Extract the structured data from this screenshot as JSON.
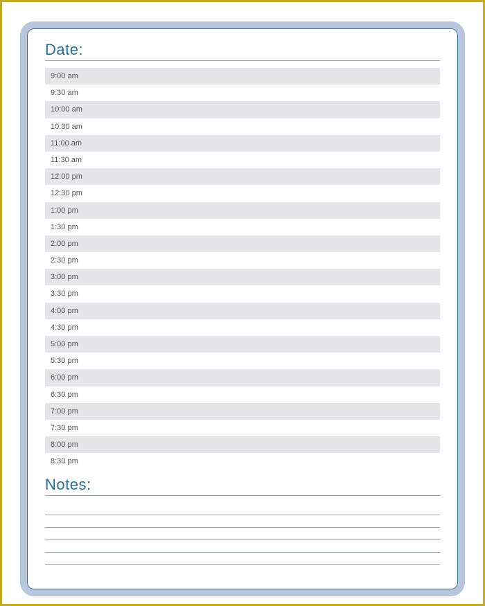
{
  "headings": {
    "date": "Date:",
    "notes": "Notes:"
  },
  "time_slots": [
    "9:00 am",
    "9:30 am",
    "10:00 am",
    "10:30 am",
    "11:00 am",
    "11:30 am",
    "12:00 pm",
    "12:30 pm",
    "1:00 pm",
    "1:30 pm",
    "2:00 pm",
    "2:30 pm",
    "3:00 pm",
    "3:30 pm",
    "4:00 pm",
    "4:30 pm",
    "5:00 pm",
    "5:30 pm",
    "6:00 pm",
    "6:30 pm",
    "7:00 pm",
    "7:30 pm",
    "8:00 pm",
    "8:30 pm"
  ],
  "notes_line_count": 5
}
